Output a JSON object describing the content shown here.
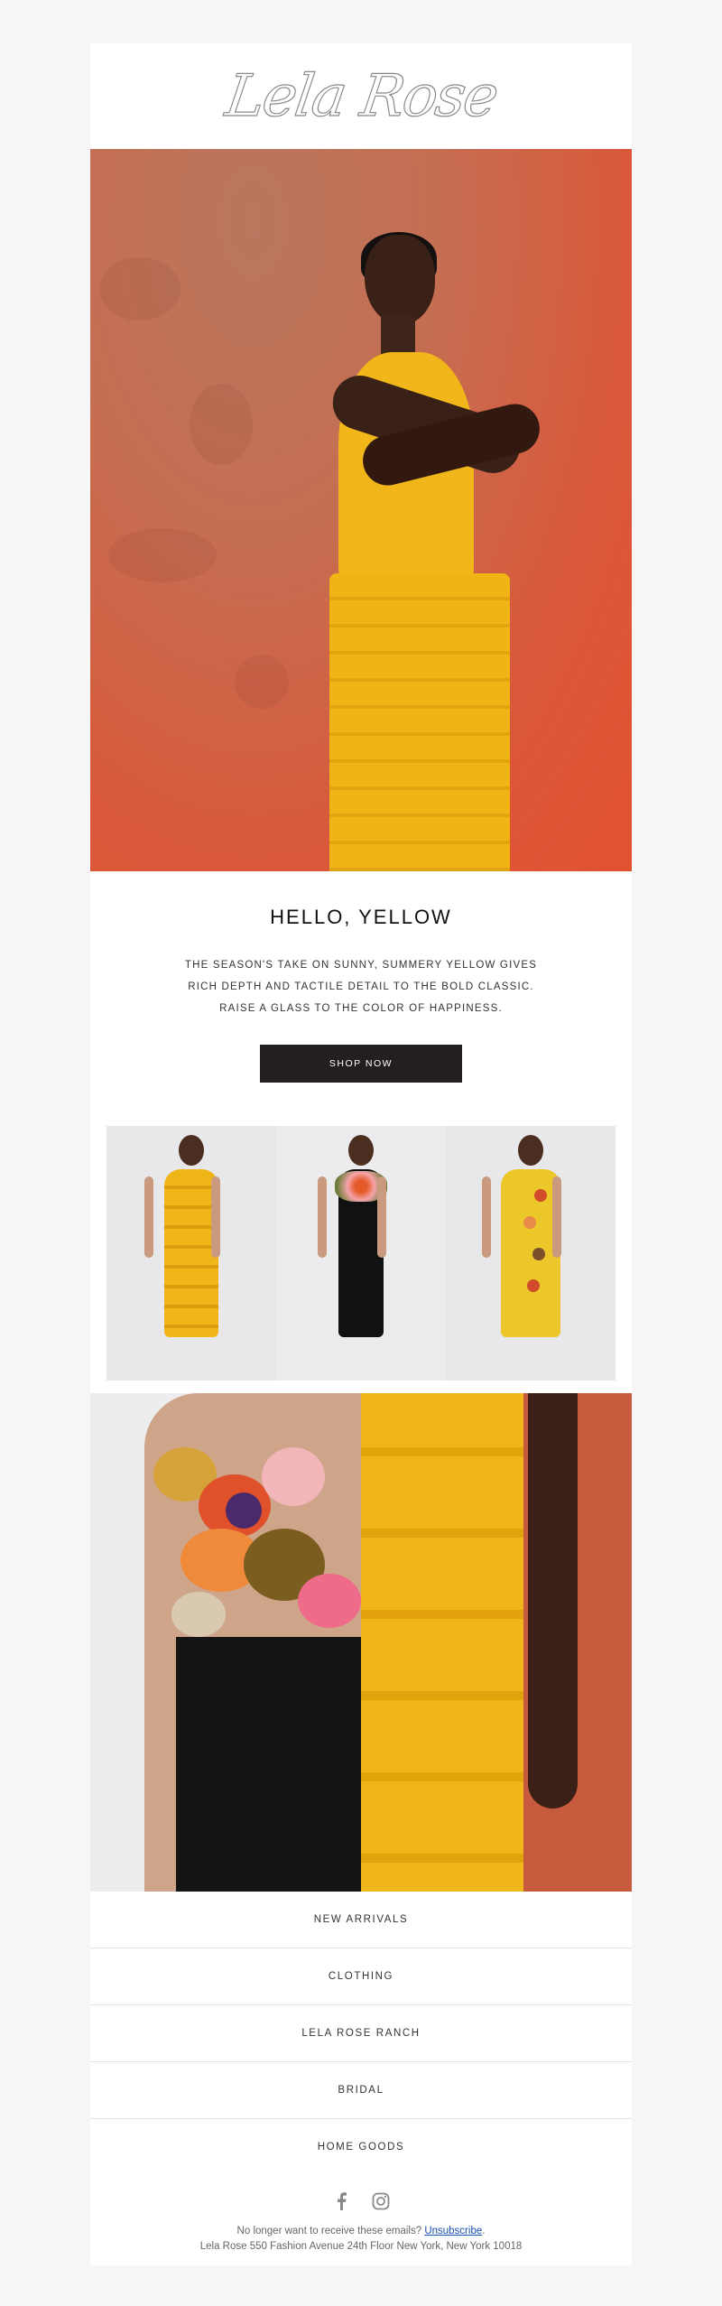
{
  "header": {
    "logo_text": "Lela Rose"
  },
  "intro": {
    "headline": "HELLO, YELLOW",
    "copy_lines": [
      "THE SEASON'S TAKE ON SUNNY, SUMMERY YELLOW GIVES",
      "RICH DEPTH AND TACTILE DETAIL TO THE BOLD CLASSIC.",
      "RAISE A GLASS TO THE COLOR OF HAPPINESS."
    ],
    "cta_label": "SHOP NOW"
  },
  "nav": {
    "items": [
      "NEW ARRIVALS",
      "CLOTHING",
      "LELA ROSE RANCH",
      "BRIDAL",
      "HOME GOODS"
    ]
  },
  "social": {
    "icons": [
      "facebook-icon",
      "instagram-icon"
    ]
  },
  "footer": {
    "unsubscribe_prompt": "No longer want to receive these emails?",
    "unsubscribe_link": "Unsubscribe",
    "unsubscribe_suffix": ".",
    "address": "Lela Rose 550 Fashion Avenue 24th Floor New York, New York 10018"
  },
  "colors": {
    "page_bg": "#f6f6f6",
    "card_bg": "#ffffff",
    "button_bg": "#231f20",
    "link": "#1a4fb0"
  }
}
